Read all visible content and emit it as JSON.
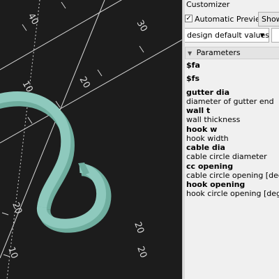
{
  "viewport": {
    "axis_labels": [
      "40",
      "30",
      "20",
      "10",
      "20",
      "10",
      "20",
      "20"
    ],
    "colors": {
      "background": "#1c1c1c",
      "model": "#8ec9bd",
      "model_edge": "#6fae9f",
      "axis": "#d8d8d8"
    }
  },
  "customizer": {
    "title": "Customizer",
    "auto_preview_checkbox": "✓",
    "auto_preview_label": "Automatic Preview",
    "show_button": "Show",
    "preset_select": "design default values",
    "preset_arrow_icon": "▼",
    "params_toggle_icon": "▼",
    "params_header": "Parameters",
    "params": [
      {
        "name": "$fa",
        "desc": ""
      },
      {
        "name": "$fs",
        "desc": ""
      },
      {
        "name": "gutter dia",
        "desc": "diameter of gutter end"
      },
      {
        "name": "wall t",
        "desc": "wall thickness"
      },
      {
        "name": "hook w",
        "desc": "hook width"
      },
      {
        "name": "cable dia",
        "desc": "cable circle diameter"
      },
      {
        "name": "cc opening",
        "desc": "cable circle opening [degrees]"
      },
      {
        "name": "hook opening",
        "desc": "hook circle opening [degrees]"
      }
    ]
  }
}
